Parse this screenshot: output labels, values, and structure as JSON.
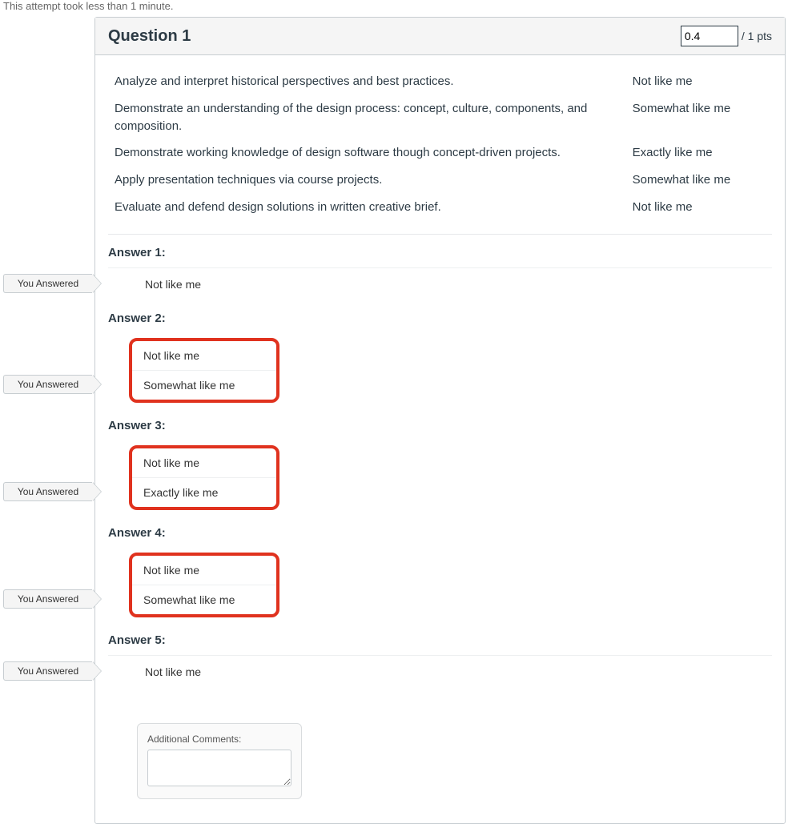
{
  "attempt_note": "This attempt took less than 1 minute.",
  "question": {
    "title": "Question 1",
    "score": "0.4",
    "pts_suffix": "/ 1 pts",
    "prompts": [
      {
        "text": "Analyze and interpret historical perspectives and best practices.",
        "response": "Not like me"
      },
      {
        "text": "Demonstrate an understanding of the design process: concept, culture, components, and composition.",
        "response": "Somewhat like me"
      },
      {
        "text": "Demonstrate working knowledge of design software though concept-driven projects.",
        "response": "Exactly like me"
      },
      {
        "text": "Apply presentation techniques via course projects.",
        "response": "Somewhat like me"
      },
      {
        "text": "Evaluate and defend design solutions in written creative brief.",
        "response": "Not like me"
      }
    ],
    "you_answered_label": "You Answered",
    "answers": [
      {
        "label": "Answer 1:",
        "given": "Not like me",
        "alt": null
      },
      {
        "label": "Answer 2:",
        "given": "Not like me",
        "alt": "Somewhat like me"
      },
      {
        "label": "Answer 3:",
        "given": "Not like me",
        "alt": "Exactly like me"
      },
      {
        "label": "Answer 4:",
        "given": "Not like me",
        "alt": "Somewhat like me"
      },
      {
        "label": "Answer 5:",
        "given": "Not like me",
        "alt": null
      }
    ],
    "comments_label": "Additional Comments:"
  }
}
